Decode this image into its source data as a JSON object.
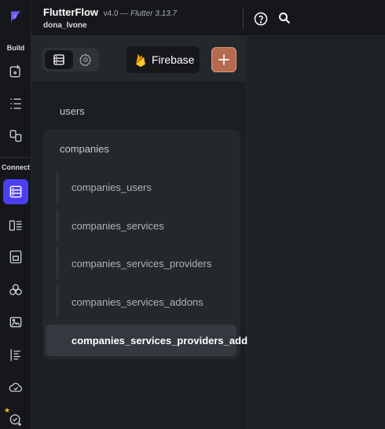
{
  "header": {
    "app_name": "FlutterFlow",
    "version": "v4.0",
    "flutter_version": " — Flutter 3.13.7",
    "project_name": "dona_lvone",
    "help_icon": "question-circle-icon",
    "search_icon": "search-icon"
  },
  "rail": {
    "build_label": "Build",
    "connect_label": "Connect",
    "accent_color": "#4b3ff0",
    "items": [
      {
        "icon": "add-page-icon"
      },
      {
        "icon": "list-tree-icon"
      },
      {
        "icon": "components-icon"
      },
      {
        "icon": "firestore-icon",
        "active": true
      },
      {
        "icon": "api-icon"
      },
      {
        "icon": "storage-icon"
      },
      {
        "icon": "integrations-icon"
      },
      {
        "icon": "media-icon"
      },
      {
        "icon": "text-icon"
      },
      {
        "icon": "cloud-icon"
      },
      {
        "icon": "check-plus-icon"
      }
    ]
  },
  "panel": {
    "firebase_label": "Firebase",
    "add_color": "#b56a4f",
    "collections": {
      "top": "users",
      "group_name": "companies",
      "subcollections": [
        "companies_users",
        "companies_services",
        "companies_services_providers",
        "companies_services_addons",
        "companies_services_providers_addons"
      ]
    }
  }
}
